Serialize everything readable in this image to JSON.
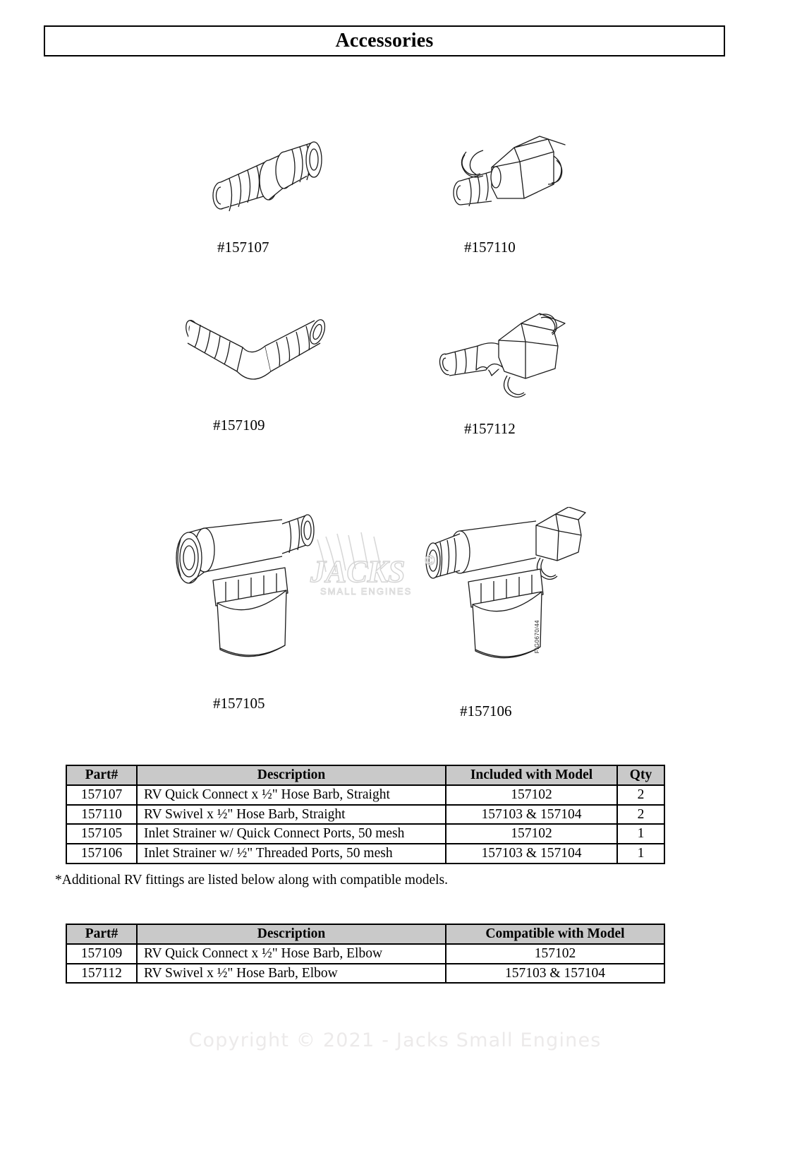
{
  "page": {
    "title": "Accessories",
    "note": "*Additional RV fittings are listed below along with compatible models.",
    "figure_code": "FIG0670/44",
    "copyright": "Copyright © 2021 - Jacks Small Engines",
    "watermark_brand": "JACKS",
    "watermark_sub": "SMALL ENGINES",
    "watermark_mark": "©"
  },
  "figures": [
    {
      "id": "fig-157107",
      "label": "#157107",
      "icon": "straight-quick-connect-hose-barb-icon"
    },
    {
      "id": "fig-157110",
      "label": "#157110",
      "icon": "straight-swivel-hose-barb-icon"
    },
    {
      "id": "fig-157109",
      "label": "#157109",
      "icon": "elbow-quick-connect-hose-barb-icon"
    },
    {
      "id": "fig-157112",
      "label": "#157112",
      "icon": "elbow-swivel-hose-barb-icon"
    },
    {
      "id": "fig-157105",
      "label": "#157105",
      "icon": "inlet-strainer-quick-connect-icon"
    },
    {
      "id": "fig-157106",
      "label": "#157106",
      "icon": "inlet-strainer-threaded-icon"
    }
  ],
  "table_included": {
    "headers": [
      "Part#",
      "Description",
      "Included with Model",
      "Qty"
    ],
    "rows": [
      [
        "157107",
        "RV Quick Connect x ½\" Hose Barb, Straight",
        "157102",
        "2"
      ],
      [
        "157110",
        "RV Swivel x ½\" Hose Barb, Straight",
        "157103 & 157104",
        "2"
      ],
      [
        "157105",
        "Inlet Strainer w/ Quick Connect Ports, 50 mesh",
        "157102",
        "1"
      ],
      [
        "157106",
        "Inlet Strainer w/ ½\" Threaded Ports, 50 mesh",
        "157103 & 157104",
        "1"
      ]
    ]
  },
  "table_compatible": {
    "headers": [
      "Part#",
      "Description",
      "Compatible with Model"
    ],
    "rows": [
      [
        "157109",
        "RV Quick Connect x ½\" Hose Barb, Elbow",
        "157102"
      ],
      [
        "157112",
        "RV Swivel x ½\" Hose Barb, Elbow",
        "157103 & 157104"
      ]
    ]
  },
  "colors": {
    "header_fill": "#c9c9c9",
    "line": "#000000",
    "watermark": "#eceaea"
  }
}
